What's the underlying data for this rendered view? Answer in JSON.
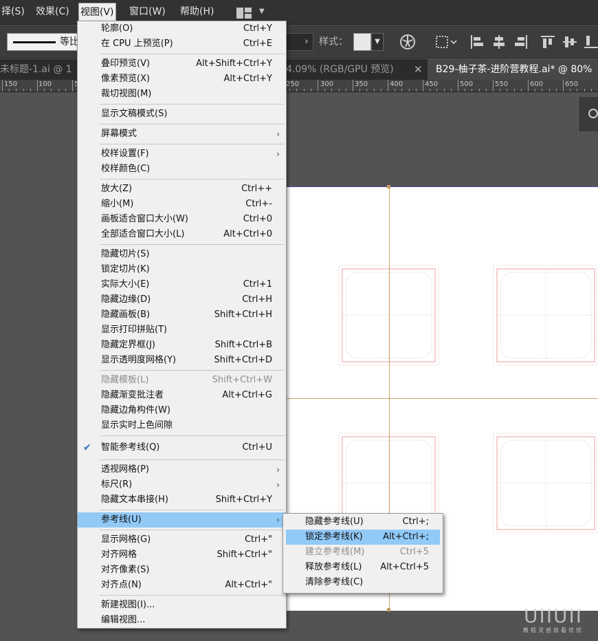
{
  "menubar": {
    "items": [
      "择(S)",
      "效果(C)",
      "视图(V)",
      "窗口(W)",
      "帮助(H)"
    ],
    "active_index": 2
  },
  "controlbar": {
    "stroke_profile_label": "等比",
    "style_label": "样式：",
    "icons": [
      "globe-icon",
      "distribute-icon",
      "align-left-icon",
      "align-center-icon",
      "align-right-icon",
      "align-top-icon",
      "align-middle-icon",
      "align-bottom-icon"
    ]
  },
  "tabs": [
    {
      "label": "未标题-1.ai @ 1",
      "active": false
    },
    {
      "label": "4.09% (RGB/GPU 预览)",
      "active": false
    },
    {
      "label": "B29-柚子茶-进阶营教程.ai* @ 80%",
      "active": true
    }
  ],
  "tab_close_glyph": "✕",
  "ruler": {
    "labels": [
      "150",
      "100",
      "5",
      "250",
      "300",
      "350",
      "400",
      "450",
      "500",
      "550",
      "600",
      "650"
    ]
  },
  "view_menu": {
    "items": [
      {
        "type": "item",
        "label": "轮廓(O)",
        "shortcut": "Ctrl+Y"
      },
      {
        "type": "item",
        "label": "在 CPU 上预览(P)",
        "shortcut": "Ctrl+E"
      },
      {
        "type": "sep"
      },
      {
        "type": "item",
        "label": "叠印预览(V)",
        "shortcut": "Alt+Shift+Ctrl+Y"
      },
      {
        "type": "item",
        "label": "像素预览(X)",
        "shortcut": "Alt+Ctrl+Y"
      },
      {
        "type": "item",
        "label": "裁切视图(M)",
        "shortcut": ""
      },
      {
        "type": "sep"
      },
      {
        "type": "item",
        "label": "显示文稿模式(S)",
        "shortcut": ""
      },
      {
        "type": "sep"
      },
      {
        "type": "item",
        "label": "屏幕模式",
        "shortcut": "",
        "submenu": true
      },
      {
        "type": "sep"
      },
      {
        "type": "item",
        "label": "校样设置(F)",
        "shortcut": "",
        "submenu": true
      },
      {
        "type": "item",
        "label": "校样颜色(C)",
        "shortcut": ""
      },
      {
        "type": "sep"
      },
      {
        "type": "item",
        "label": "放大(Z)",
        "shortcut": "Ctrl++"
      },
      {
        "type": "item",
        "label": "缩小(M)",
        "shortcut": "Ctrl+-"
      },
      {
        "type": "item",
        "label": "画板适合窗口大小(W)",
        "shortcut": "Ctrl+0"
      },
      {
        "type": "item",
        "label": "全部适合窗口大小(L)",
        "shortcut": "Alt+Ctrl+0"
      },
      {
        "type": "sep"
      },
      {
        "type": "item",
        "label": "隐藏切片(S)",
        "shortcut": ""
      },
      {
        "type": "item",
        "label": "锁定切片(K)",
        "shortcut": ""
      },
      {
        "type": "item",
        "label": "实际大小(E)",
        "shortcut": "Ctrl+1"
      },
      {
        "type": "item",
        "label": "隐藏边缘(D)",
        "shortcut": "Ctrl+H"
      },
      {
        "type": "item",
        "label": "隐藏画板(B)",
        "shortcut": "Shift+Ctrl+H"
      },
      {
        "type": "item",
        "label": "显示打印拼贴(T)",
        "shortcut": ""
      },
      {
        "type": "item",
        "label": "隐藏定界框(J)",
        "shortcut": "Shift+Ctrl+B"
      },
      {
        "type": "item",
        "label": "显示透明度网格(Y)",
        "shortcut": "Shift+Ctrl+D"
      },
      {
        "type": "sep"
      },
      {
        "type": "item",
        "label": "隐藏模板(L)",
        "shortcut": "Shift+Ctrl+W",
        "disabled": true
      },
      {
        "type": "item",
        "label": "隐藏渐变批注者",
        "shortcut": "Alt+Ctrl+G"
      },
      {
        "type": "item",
        "label": "隐藏边角构件(W)",
        "shortcut": ""
      },
      {
        "type": "item",
        "label": "显示实时上色间隙",
        "shortcut": ""
      },
      {
        "type": "sep"
      },
      {
        "type": "item",
        "label": "智能参考线(Q)",
        "shortcut": "Ctrl+U",
        "checked": true,
        "tall": true
      },
      {
        "type": "sep"
      },
      {
        "type": "item",
        "label": "透视网格(P)",
        "shortcut": "",
        "submenu": true
      },
      {
        "type": "item",
        "label": "标尺(R)",
        "shortcut": "",
        "submenu": true
      },
      {
        "type": "item",
        "label": "隐藏文本串接(H)",
        "shortcut": "Shift+Ctrl+Y"
      },
      {
        "type": "sep"
      },
      {
        "type": "item",
        "label": "参考线(U)",
        "shortcut": "",
        "submenu": true,
        "highlight": true
      },
      {
        "type": "sep"
      },
      {
        "type": "item",
        "label": "显示网格(G)",
        "shortcut": "Ctrl+\""
      },
      {
        "type": "item",
        "label": "对齐网格",
        "shortcut": "Shift+Ctrl+\""
      },
      {
        "type": "item",
        "label": "对齐像素(S)",
        "shortcut": ""
      },
      {
        "type": "item",
        "label": "对齐点(N)",
        "shortcut": "Alt+Ctrl+\""
      },
      {
        "type": "sep"
      },
      {
        "type": "item",
        "label": "新建视图(I)...",
        "shortcut": ""
      },
      {
        "type": "item",
        "label": "编辑视图...",
        "shortcut": ""
      }
    ]
  },
  "guides_submenu": {
    "items": [
      {
        "label": "隐藏参考线(U)",
        "shortcut": "Ctrl+;"
      },
      {
        "label": "锁定参考线(K)",
        "shortcut": "Alt+Ctrl+;",
        "highlight": true
      },
      {
        "label": "建立参考线(M)",
        "shortcut": "Ctrl+5",
        "disabled": true
      },
      {
        "label": "释放参考线(L)",
        "shortcut": "Alt+Ctrl+5"
      },
      {
        "label": "清除参考线(C)",
        "shortcut": ""
      }
    ]
  },
  "watermark": {
    "big": "UIIUII",
    "small": "教程灵感就看优优"
  },
  "colors": {
    "app_bg": "#535353",
    "menu_bg": "#f0f0f0",
    "menu_highlight": "#91c9f7",
    "guide": "#c8a06a",
    "shape_stroke": "#e8a0a0"
  }
}
